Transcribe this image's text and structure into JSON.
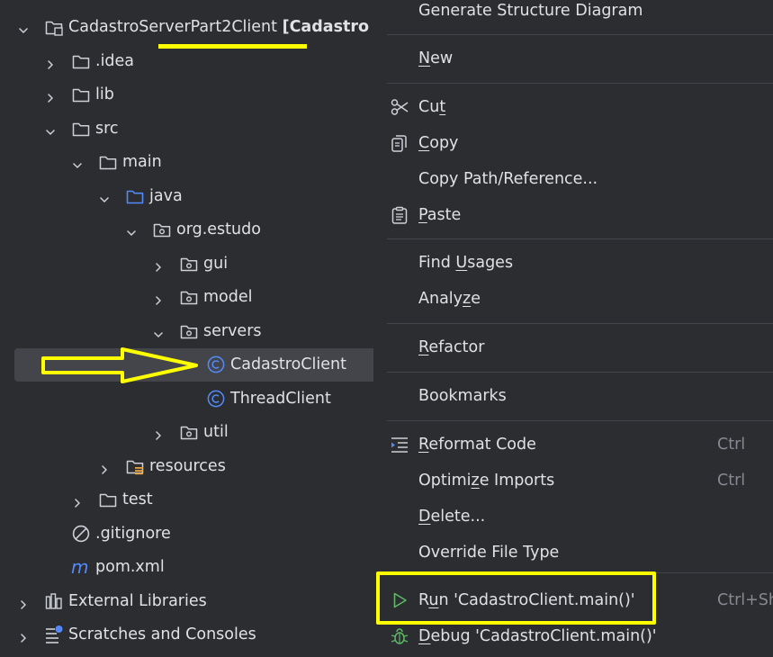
{
  "tree": {
    "rows": [
      {
        "label": "CadastroServerPart2Client",
        "suffix": "[Cadastro",
        "icon": "module-folder-icon"
      },
      {
        "label": ".idea",
        "icon": "folder-icon"
      },
      {
        "label": "lib",
        "icon": "folder-icon"
      },
      {
        "label": "src",
        "icon": "folder-icon"
      },
      {
        "label": "main",
        "icon": "folder-icon"
      },
      {
        "label": "java",
        "icon": "source-root-folder-icon"
      },
      {
        "label": "org.estudo",
        "icon": "package-icon"
      },
      {
        "label": "gui",
        "icon": "package-icon"
      },
      {
        "label": "model",
        "icon": "package-icon"
      },
      {
        "label": "servers",
        "icon": "package-icon"
      },
      {
        "label": "CadastroClient",
        "icon": "java-class-icon",
        "selected": true
      },
      {
        "label": "ThreadClient",
        "icon": "java-class-icon"
      },
      {
        "label": "util",
        "icon": "package-icon"
      },
      {
        "label": "resources",
        "icon": "resources-folder-icon"
      },
      {
        "label": "test",
        "icon": "folder-icon"
      },
      {
        "label": ".gitignore",
        "icon": "ignored-file-icon"
      },
      {
        "label": "pom.xml",
        "icon": "maven-icon"
      },
      {
        "label": "External Libraries",
        "icon": "libraries-icon"
      },
      {
        "label": "Scratches and Consoles",
        "icon": "scratches-icon"
      }
    ]
  },
  "context_menu": {
    "items": [
      {
        "pre": "Generate Structure Diagram",
        "u": "",
        "post": ""
      },
      {
        "pre": "",
        "u": "N",
        "post": "ew"
      },
      {
        "pre": "Cu",
        "u": "t",
        "post": "",
        "icon": "scissors-icon"
      },
      {
        "pre": "",
        "u": "C",
        "post": "opy",
        "icon": "copy-icon"
      },
      {
        "pre": "Copy Path/Reference...",
        "u": "",
        "post": ""
      },
      {
        "pre": "",
        "u": "P",
        "post": "aste",
        "icon": "paste-icon"
      },
      {
        "pre": "Find ",
        "u": "U",
        "post": "sages"
      },
      {
        "pre": "Analy",
        "u": "z",
        "post": "e"
      },
      {
        "pre": "",
        "u": "R",
        "post": "efactor"
      },
      {
        "pre": "Bookmarks",
        "u": "",
        "post": ""
      },
      {
        "pre": "",
        "u": "R",
        "post": "eformat Code",
        "icon": "reformat-icon",
        "shortcut": "Ctrl"
      },
      {
        "pre": "Optimi",
        "u": "z",
        "post": "e Imports",
        "shortcut": "Ctrl"
      },
      {
        "pre": "",
        "u": "D",
        "post": "elete..."
      },
      {
        "pre": "Override File Type",
        "u": "",
        "post": ""
      },
      {
        "pre": "R",
        "u": "u",
        "post": "n 'CadastroClient.main()'",
        "icon": "run-icon",
        "shortcut": "Ctrl+Sh"
      },
      {
        "pre": "",
        "u": "D",
        "post": "ebug 'CadastroClient.main()'",
        "icon": "debug-icon"
      }
    ]
  },
  "colors": {
    "background": "#2b2d30",
    "selection": "#43454a",
    "text": "#dfe1e5",
    "annotation": "#ffff00",
    "run_green": "#5fb865",
    "class_blue": "#548af7"
  }
}
